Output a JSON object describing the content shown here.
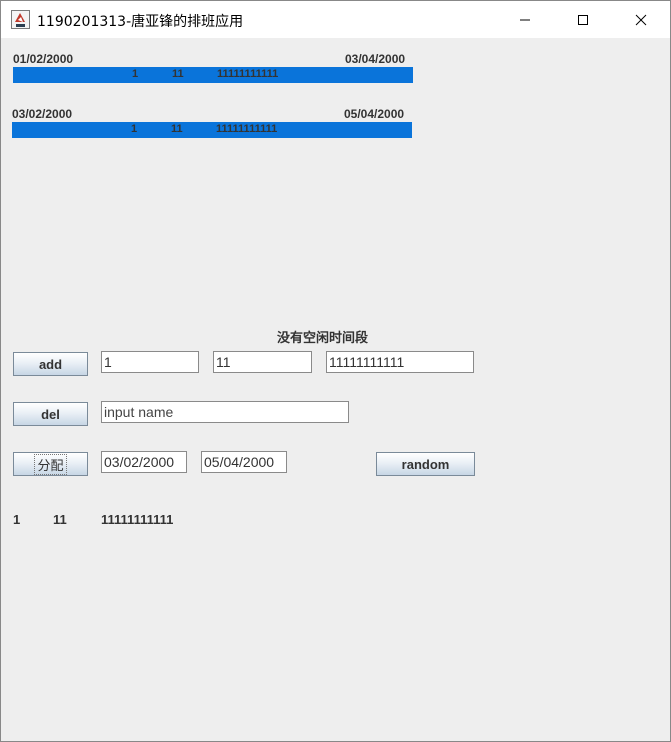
{
  "window": {
    "title": "1190201313-唐亚锋的排班应用",
    "app_icon": "java-cup-icon"
  },
  "schedule": [
    {
      "start_date": "01/02/2000",
      "end_date": "03/04/2000",
      "bar_color": "#0a74da",
      "name": "1",
      "dept": "11",
      "phone": "11111111111"
    },
    {
      "start_date": "03/02/2000",
      "end_date": "05/04/2000",
      "bar_color": "#0a74da",
      "name": "1",
      "dept": "11",
      "phone": "11111111111"
    }
  ],
  "status_text": "没有空闲时间段",
  "add_row": {
    "button_label": "add",
    "name_value": "1",
    "dept_value": "11",
    "phone_value": "11111111111"
  },
  "del_row": {
    "button_label": "del",
    "name_value": "input name"
  },
  "assign_row": {
    "button_label": "分配",
    "start_value": "03/02/2000",
    "end_value": "05/04/2000",
    "random_label": "random"
  },
  "employee_list": [
    {
      "name": "1",
      "dept": "11",
      "phone": "11111111111"
    }
  ]
}
